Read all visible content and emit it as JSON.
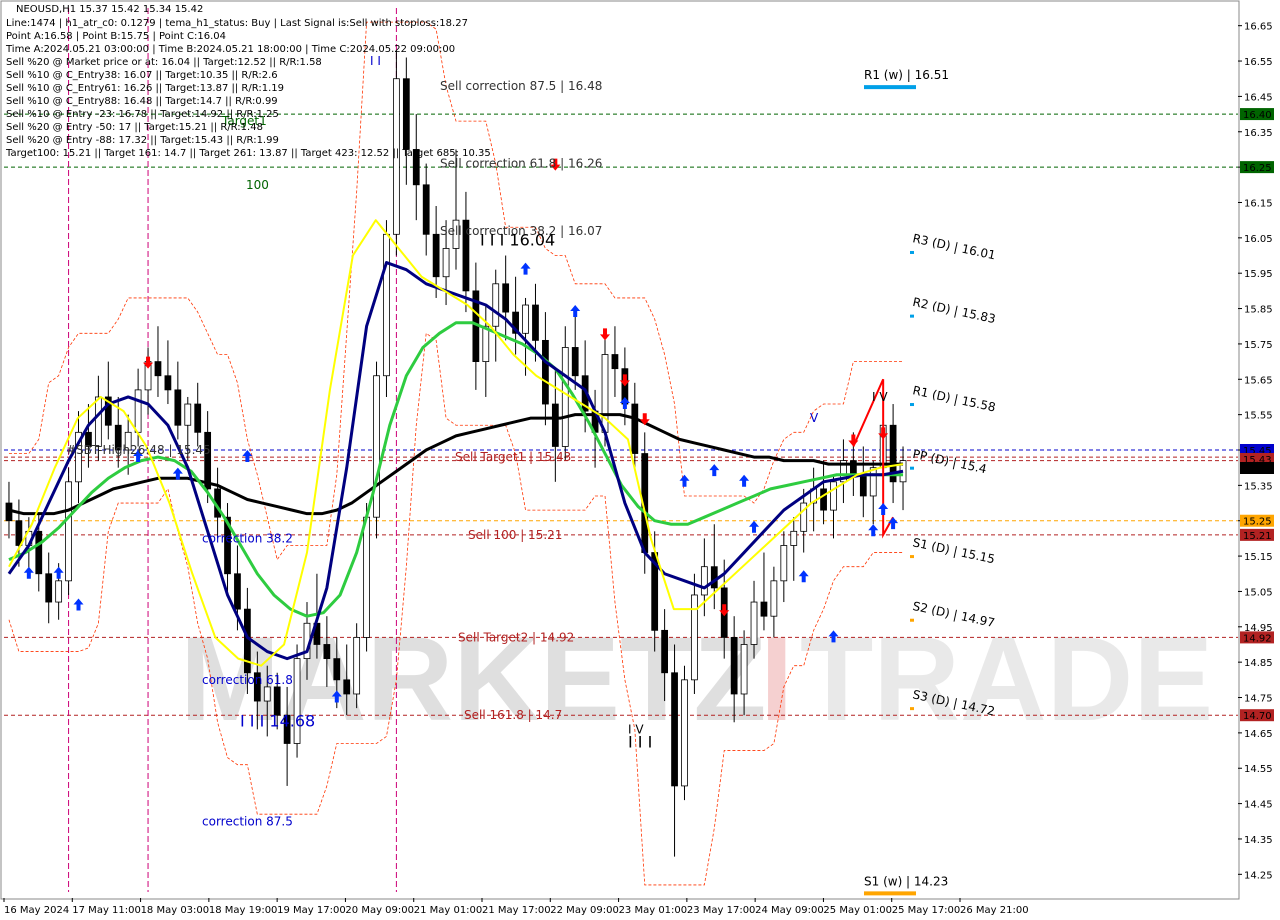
{
  "header": {
    "symbol_line": "NEOUSD,H1  15.37 15.42 15.34 15.42",
    "info_lines": [
      "Line:1474  |  h1_atr_c0: 0.1279  |  tema_h1_status: Buy  |  Last Signal is:Sell with stoploss:18.27",
      "Point A:16.58  |  Point B:15.75  |  Point C:16.04",
      "Time A:2024.05.21 03:00:00  |  Time B:2024.05.21 18:00:00  |  Time C:2024.05.22 09:00:00",
      "Sell %20 @ Market price or at: 16.04  ||  Target:12.52  ||  R/R:1.58",
      "Sell %10 @ C_Entry38: 16.07  ||  Target:10.35  ||  R/R:2.6",
      "Sell %10 @ C_Entry61: 16.26  ||  Target:13.87  ||  R/R:1.19",
      "Sell %10 @ C_Entry88: 16.48  ||  Target:14.7  ||  R/R:0.99",
      "Sell %10 @ Entry -23: 16.78  ||  Target:14.92  ||  R/R:1.25",
      "Sell %20 @ Entry -50: 17  ||  Target:15.21  ||  R/R:1.48",
      "Sell %20 @ Entry -88: 17.32  ||  Target:15.43  ||  R/R:1.99",
      "Target100: 15.21  ||  Target 161: 14.7  ||  Target 261: 13.87  ||  Target 423: 12.52  ||  Target 685: 10.35"
    ]
  },
  "watermark": {
    "left": "MARKETZ",
    "i": "I",
    "right": "TRADE"
  },
  "colors": {
    "background": "#ffffff",
    "bull_candle": "#ffffff",
    "bear_candle": "#000000",
    "ma_black": "#000000",
    "ma_green": "#2ecc40",
    "ma_navy": "#000080",
    "ma_yellow": "#ffff00",
    "envelope": "#ff3300",
    "green_level": "#006400",
    "red_level": "#b22222",
    "blue_level": "#0000cc",
    "orange_level": "#ffa500",
    "magenta_vline": "#cc0077",
    "arrow_up": "#0033ff",
    "arrow_down": "#ff0000",
    "pivot_w": "#00a0e8",
    "s1w": "#ffa500"
  },
  "chart_data": {
    "type": "candlestick",
    "symbol": "NEOUSD",
    "timeframe": "H1",
    "ylim": [
      14.2,
      16.7
    ],
    "y_ticks": [
      "16.65",
      "16.55",
      "16.45",
      "16.35",
      "16.25",
      "16.15",
      "16.05",
      "15.95",
      "15.85",
      "15.75",
      "15.65",
      "15.55",
      "15.45",
      "15.35",
      "15.25",
      "15.15",
      "15.05",
      "14.95",
      "14.85",
      "14.75",
      "14.65",
      "14.55",
      "14.45",
      "14.35",
      "14.25"
    ],
    "x_ticks": [
      "16 May 2024",
      "17 May 11:00",
      "18 May 03:00",
      "18 May 19:00",
      "19 May 17:00",
      "20 May 09:00",
      "21 May 01:00",
      "21 May 17:00",
      "22 May 09:00",
      "23 May 01:00",
      "23 May 17:00",
      "24 May 09:00",
      "25 May 01:00",
      "25 May 17:00",
      "26 May 21:00"
    ],
    "price_tags": [
      {
        "value": 16.4,
        "text": "16.40",
        "bg": "#006400"
      },
      {
        "value": 16.25,
        "text": "16.25",
        "bg": "#006400"
      },
      {
        "value": 15.45,
        "text": "15.45",
        "bg": "#0000cc"
      },
      {
        "value": 15.43,
        "text": "15.43",
        "bg": "#b22222"
      },
      {
        "value": 15.42,
        "text": "15.42",
        "bg": "#000000"
      },
      {
        "value": 15.25,
        "text": "15.25",
        "bg": "#ffa500"
      },
      {
        "value": 15.21,
        "text": "15.21",
        "bg": "#b22222"
      },
      {
        "value": 14.92,
        "text": "14.92",
        "bg": "#b22222"
      },
      {
        "value": 14.7,
        "text": "14.70",
        "bg": "#b22222"
      }
    ],
    "hlines": [
      {
        "value": 16.4,
        "color": "#006400"
      },
      {
        "value": 16.25,
        "color": "#006400"
      },
      {
        "value": 15.45,
        "color": "#0000cc"
      },
      {
        "value": 15.43,
        "color": "#b22222"
      },
      {
        "value": 15.42,
        "color": "#b22222"
      },
      {
        "value": 15.25,
        "color": "#ffa500"
      },
      {
        "value": 15.21,
        "color": "#b22222"
      },
      {
        "value": 14.92,
        "color": "#b22222"
      },
      {
        "value": 14.7,
        "color": "#b22222"
      }
    ],
    "level_labels": [
      {
        "text": "Sell correction 87.5 | 16.48",
        "value": 16.48,
        "color": "#333333"
      },
      {
        "text": "Sell correction 61.8 | 16.26",
        "value": 16.26,
        "color": "#333333"
      },
      {
        "text": "Sell correction 38.2 | 16.07",
        "value": 16.07,
        "color": "#333333"
      },
      {
        "text": "Sell Target1 | 15.43",
        "value": 15.43,
        "color": "#b22222"
      },
      {
        "text": "Sell 100 | 15.21",
        "value": 15.21,
        "color": "#b22222"
      },
      {
        "text": "Sell Target2 | 14.92",
        "value": 14.92,
        "color": "#b22222"
      },
      {
        "text": "Sell 161.8 | 14.7",
        "value": 14.7,
        "color": "#b22222"
      },
      {
        "text": "I I I 16.04",
        "value": 16.04,
        "color": "#000000"
      },
      {
        "text": "I I I 14.68",
        "value": 14.68,
        "color": "#0000cc"
      },
      {
        "text": "correction 38.2",
        "value": 15.2,
        "color": "#0000cc"
      },
      {
        "text": "correction 61.8",
        "value": 14.8,
        "color": "#0000cc"
      },
      {
        "text": "correction 87.5",
        "value": 14.4,
        "color": "#0000cc"
      },
      {
        "text": "100",
        "value": 16.2,
        "color": "#006400"
      },
      {
        "text": "Target1",
        "value": 16.38,
        "color": "#006400"
      },
      {
        "text": "#SBT-High26:48 | 15.45",
        "value": 15.45,
        "color": "#333333"
      },
      {
        "text": "I V",
        "value": 15.6,
        "color": "#000000"
      },
      {
        "text": "I V",
        "value": 14.66,
        "color": "#000000"
      },
      {
        "text": "I I I",
        "value": 14.62,
        "color": "#000000"
      },
      {
        "text": "V",
        "value": 15.54,
        "color": "#0000cc"
      },
      {
        "text": "I I",
        "value": 16.55,
        "color": "#0000cc"
      }
    ],
    "pivots": [
      {
        "text": "R1 (w) | 16.51",
        "value": 16.51,
        "marker": "#00a0e8"
      },
      {
        "text": "R3 (D) | 16.01",
        "value": 16.01,
        "marker": "#00a0e8"
      },
      {
        "text": "R2 (D) | 15.83",
        "value": 15.83,
        "marker": "#00a0e8"
      },
      {
        "text": "R1 (D) | 15.58",
        "value": 15.58,
        "marker": "#00a0e8"
      },
      {
        "text": "PP (D) | 15.4",
        "value": 15.4,
        "marker": "#00a0e8"
      },
      {
        "text": "S1 (D) | 15.15",
        "value": 15.15,
        "marker": "#ffa500"
      },
      {
        "text": "S2 (D) | 14.97",
        "value": 14.97,
        "marker": "#ffa500"
      },
      {
        "text": "S3 (D) | 14.72",
        "value": 14.72,
        "marker": "#ffa500"
      },
      {
        "text": "S1 (w) | 14.23",
        "value": 14.23,
        "marker": "#ffa500"
      }
    ],
    "candles": [
      [
        15.3,
        15.36,
        15.2,
        15.25
      ],
      [
        15.25,
        15.31,
        15.12,
        15.18
      ],
      [
        15.18,
        15.26,
        15.1,
        15.22
      ],
      [
        15.22,
        15.27,
        15.05,
        15.1
      ],
      [
        15.1,
        15.16,
        14.96,
        15.02
      ],
      [
        15.02,
        15.13,
        14.97,
        15.08
      ],
      [
        15.08,
        15.4,
        15.04,
        15.36
      ],
      [
        15.36,
        15.56,
        15.3,
        15.5
      ],
      [
        15.5,
        15.58,
        15.4,
        15.46
      ],
      [
        15.46,
        15.66,
        15.42,
        15.6
      ],
      [
        15.6,
        15.7,
        15.48,
        15.52
      ],
      [
        15.52,
        15.6,
        15.4,
        15.45
      ],
      [
        15.45,
        15.55,
        15.38,
        15.5
      ],
      [
        15.5,
        15.68,
        15.46,
        15.62
      ],
      [
        15.62,
        15.74,
        15.55,
        15.7
      ],
      [
        15.7,
        15.8,
        15.6,
        15.66
      ],
      [
        15.66,
        15.76,
        15.58,
        15.62
      ],
      [
        15.62,
        15.7,
        15.48,
        15.52
      ],
      [
        15.52,
        15.6,
        15.42,
        15.58
      ],
      [
        15.58,
        15.64,
        15.46,
        15.5
      ],
      [
        15.5,
        15.56,
        15.3,
        15.34
      ],
      [
        15.34,
        15.4,
        15.2,
        15.26
      ],
      [
        15.26,
        15.3,
        15.04,
        15.1
      ],
      [
        15.1,
        15.18,
        14.94,
        15.0
      ],
      [
        15.0,
        15.06,
        14.76,
        14.82
      ],
      [
        14.82,
        14.88,
        14.66,
        14.74
      ],
      [
        14.74,
        14.84,
        14.64,
        14.78
      ],
      [
        14.78,
        14.82,
        14.66,
        14.7
      ],
      [
        14.7,
        14.78,
        14.5,
        14.62
      ],
      [
        14.62,
        14.9,
        14.58,
        14.86
      ],
      [
        14.86,
        15.02,
        14.8,
        14.96
      ],
      [
        14.96,
        15.1,
        14.86,
        14.9
      ],
      [
        14.9,
        14.98,
        14.78,
        14.86
      ],
      [
        14.86,
        14.92,
        14.72,
        14.8
      ],
      [
        14.8,
        14.9,
        14.7,
        14.76
      ],
      [
        14.76,
        14.96,
        14.72,
        14.92
      ],
      [
        14.92,
        15.3,
        14.88,
        15.26
      ],
      [
        15.26,
        15.7,
        15.2,
        15.66
      ],
      [
        15.66,
        16.1,
        15.6,
        16.06
      ],
      [
        16.06,
        16.58,
        16.0,
        16.5
      ],
      [
        16.5,
        16.56,
        16.2,
        16.3
      ],
      [
        16.3,
        16.4,
        16.1,
        16.2
      ],
      [
        16.2,
        16.26,
        16.0,
        16.06
      ],
      [
        16.06,
        16.14,
        15.88,
        15.94
      ],
      [
        15.94,
        16.1,
        15.86,
        16.02
      ],
      [
        16.02,
        16.3,
        15.96,
        16.1
      ],
      [
        16.1,
        16.18,
        15.84,
        15.9
      ],
      [
        15.9,
        15.98,
        15.62,
        15.7
      ],
      [
        15.7,
        15.86,
        15.6,
        15.8
      ],
      [
        15.8,
        15.96,
        15.7,
        15.92
      ],
      [
        15.92,
        16.0,
        15.76,
        15.84
      ],
      [
        15.84,
        15.94,
        15.72,
        15.78
      ],
      [
        15.78,
        15.88,
        15.66,
        15.86
      ],
      [
        15.86,
        15.92,
        15.7,
        15.76
      ],
      [
        15.76,
        15.84,
        15.52,
        15.58
      ],
      [
        15.58,
        15.68,
        15.36,
        15.46
      ],
      [
        15.46,
        15.8,
        15.42,
        15.74
      ],
      [
        15.74,
        15.84,
        15.62,
        15.66
      ],
      [
        15.66,
        15.76,
        15.5,
        15.56
      ],
      [
        15.56,
        15.62,
        15.4,
        15.5
      ],
      [
        15.5,
        15.78,
        15.46,
        15.72
      ],
      [
        15.72,
        15.8,
        15.6,
        15.68
      ],
      [
        15.68,
        15.74,
        15.52,
        15.58
      ],
      [
        15.58,
        15.64,
        15.4,
        15.44
      ],
      [
        15.44,
        15.5,
        15.1,
        15.16
      ],
      [
        15.16,
        15.22,
        14.88,
        14.94
      ],
      [
        14.94,
        15.0,
        14.74,
        14.82
      ],
      [
        14.82,
        14.9,
        14.3,
        14.5
      ],
      [
        14.5,
        14.84,
        14.46,
        14.8
      ],
      [
        14.8,
        15.1,
        14.76,
        15.04
      ],
      [
        15.04,
        15.2,
        14.98,
        15.12
      ],
      [
        15.12,
        15.24,
        15.0,
        15.06
      ],
      [
        15.06,
        15.14,
        14.86,
        14.92
      ],
      [
        14.92,
        14.98,
        14.68,
        14.76
      ],
      [
        14.76,
        14.94,
        14.7,
        14.9
      ],
      [
        14.9,
        15.08,
        14.86,
        15.02
      ],
      [
        15.02,
        15.16,
        14.94,
        14.98
      ],
      [
        14.98,
        15.12,
        14.92,
        15.08
      ],
      [
        15.08,
        15.22,
        15.02,
        15.18
      ],
      [
        15.18,
        15.26,
        15.08,
        15.22
      ],
      [
        15.22,
        15.34,
        15.16,
        15.3
      ],
      [
        15.3,
        15.4,
        15.22,
        15.34
      ],
      [
        15.34,
        15.42,
        15.24,
        15.28
      ],
      [
        15.28,
        15.38,
        15.2,
        15.36
      ],
      [
        15.36,
        15.48,
        15.3,
        15.42
      ],
      [
        15.42,
        15.5,
        15.32,
        15.38
      ],
      [
        15.38,
        15.46,
        15.26,
        15.32
      ],
      [
        15.32,
        15.42,
        15.24,
        15.4
      ],
      [
        15.4,
        15.62,
        15.34,
        15.52
      ],
      [
        15.52,
        15.58,
        15.3,
        15.36
      ],
      [
        15.36,
        15.46,
        15.28,
        15.42
      ]
    ],
    "ma_black": [
      15.28,
      15.27,
      15.27,
      15.27,
      15.28,
      15.3,
      15.32,
      15.34,
      15.35,
      15.36,
      15.37,
      15.37,
      15.37,
      15.36,
      15.35,
      15.33,
      15.31,
      15.3,
      15.29,
      15.28,
      15.27,
      15.27,
      15.28,
      15.3,
      15.33,
      15.36,
      15.39,
      15.42,
      15.45,
      15.47,
      15.49,
      15.5,
      15.51,
      15.52,
      15.53,
      15.54,
      15.54,
      15.54,
      15.55,
      15.55,
      15.55,
      15.55,
      15.54,
      15.52,
      15.5,
      15.48,
      15.47,
      15.46,
      15.45,
      15.44,
      15.43,
      15.43,
      15.42,
      15.42,
      15.42,
      15.41,
      15.41,
      15.41,
      15.41,
      15.41,
      15.41
    ],
    "ma_green": [
      15.14,
      15.16,
      15.19,
      15.23,
      15.28,
      15.33,
      15.37,
      15.4,
      15.42,
      15.43,
      15.42,
      15.39,
      15.33,
      15.26,
      15.18,
      15.1,
      15.04,
      15.0,
      14.98,
      14.99,
      15.04,
      15.16,
      15.33,
      15.52,
      15.66,
      15.74,
      15.78,
      15.81,
      15.81,
      15.79,
      15.77,
      15.75,
      15.72,
      15.68,
      15.61,
      15.53,
      15.44,
      15.35,
      15.29,
      15.25,
      15.24,
      15.24,
      15.26,
      15.28,
      15.3,
      15.32,
      15.34,
      15.35,
      15.36,
      15.37,
      15.38,
      15.38,
      15.38,
      15.38,
      15.38
    ],
    "ma_navy": [
      15.1,
      15.18,
      15.3,
      15.42,
      15.52,
      15.58,
      15.6,
      15.58,
      15.52,
      15.4,
      15.22,
      15.04,
      14.92,
      14.88,
      14.86,
      14.88,
      15.06,
      15.4,
      15.8,
      15.98,
      15.96,
      15.92,
      15.9,
      15.88,
      15.86,
      15.82,
      15.76,
      15.7,
      15.66,
      15.62,
      15.5,
      15.3,
      15.16,
      15.1,
      15.08,
      15.06,
      15.1,
      15.16,
      15.22,
      15.28,
      15.32,
      15.36,
      15.37,
      15.38,
      15.38,
      15.39
    ],
    "ma_yellow": [
      15.12,
      15.24,
      15.4,
      15.54,
      15.6,
      15.56,
      15.46,
      15.3,
      15.1,
      14.92,
      14.86,
      14.84,
      14.9,
      15.16,
      15.62,
      16.0,
      16.1,
      16.02,
      15.94,
      15.9,
      15.86,
      15.8,
      15.72,
      15.66,
      15.62,
      15.58,
      15.54,
      15.48,
      15.2,
      15.0,
      15.0,
      15.06,
      15.12,
      15.18,
      15.24,
      15.3,
      15.34,
      15.38,
      15.4,
      15.41
    ],
    "arrows_up": [
      [
        2,
        15.12
      ],
      [
        5,
        15.12
      ],
      [
        7,
        15.03
      ],
      [
        13,
        15.45
      ],
      [
        17,
        15.4
      ],
      [
        24,
        15.45
      ],
      [
        33,
        14.77
      ],
      [
        52,
        15.98
      ],
      [
        57,
        15.86
      ],
      [
        62,
        15.6
      ],
      [
        68,
        15.38
      ],
      [
        71,
        15.41
      ],
      [
        74,
        15.38
      ],
      [
        75,
        15.25
      ],
      [
        80,
        15.11
      ],
      [
        83,
        14.94
      ],
      [
        87,
        15.24
      ],
      [
        88,
        15.3
      ],
      [
        89,
        15.26
      ]
    ],
    "arrows_down": [
      [
        14,
        15.68
      ],
      [
        55,
        16.24
      ],
      [
        60,
        15.76
      ],
      [
        62,
        15.63
      ],
      [
        64,
        15.52
      ],
      [
        72,
        14.98
      ],
      [
        85,
        15.46
      ],
      [
        88,
        15.48
      ]
    ],
    "v_lines": [
      6,
      14,
      39
    ],
    "red_trend": [
      [
        85,
        15.46
      ],
      [
        88,
        15.65
      ],
      [
        88,
        15.21
      ],
      [
        89,
        15.26
      ]
    ]
  }
}
